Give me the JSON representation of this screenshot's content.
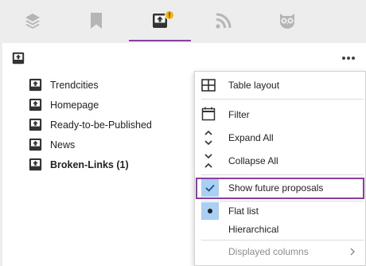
{
  "tabs": [
    {
      "name": "layers",
      "icon": "layers-icon",
      "active": false
    },
    {
      "name": "bookmarks",
      "icon": "bookmark-icon",
      "active": false
    },
    {
      "name": "proposals",
      "icon": "upload-box-icon",
      "active": true,
      "badge": "!"
    },
    {
      "name": "feeds",
      "icon": "rss-icon",
      "active": false
    },
    {
      "name": "owl",
      "icon": "owl-icon",
      "active": false
    }
  ],
  "panel": {
    "header_icon": "upload-box-icon",
    "more_icon": "more-horizontal-icon"
  },
  "list": [
    {
      "label": "Trendcities",
      "bold": false
    },
    {
      "label": "Homepage",
      "bold": false
    },
    {
      "label": "Ready-to-be-Published",
      "bold": false
    },
    {
      "label": "News",
      "bold": false
    },
    {
      "label": "Broken-Links (1)",
      "bold": true
    }
  ],
  "menu": {
    "table_layout": "Table layout",
    "filter": "Filter",
    "expand_all": "Expand All",
    "collapse_all": "Collapse All",
    "show_future_proposals": "Show future proposals",
    "show_future_proposals_checked": true,
    "flat_list": "Flat list",
    "flat_list_selected": true,
    "hierarchical": "Hierarchical",
    "displayed_columns": "Displayed columns"
  },
  "colors": {
    "accent": "#8a3ea0",
    "badge": "#f4b30a",
    "check_bg": "#a9cff2",
    "icon_gray": "#b5b5b5"
  }
}
